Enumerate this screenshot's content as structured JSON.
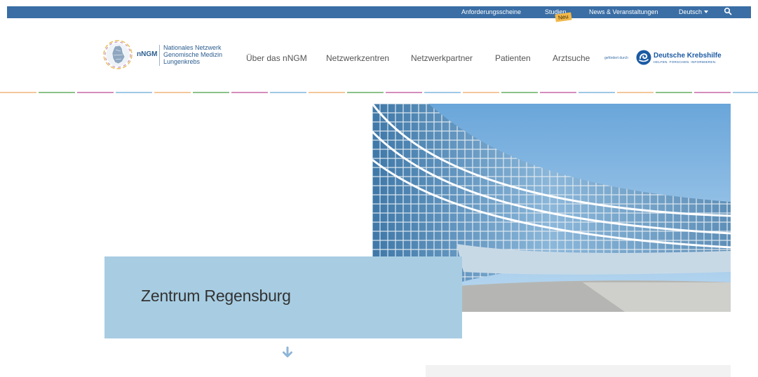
{
  "topbar": {
    "links": [
      "Anforderungsscheine",
      "Studien",
      "News & Veranstaltungen"
    ],
    "badge": "Neu",
    "language": "Deutsch",
    "icons": {
      "search": "search-icon",
      "language_caret": "caret-down-icon"
    },
    "color": "#3a6ea5"
  },
  "logo": {
    "acronym": "nNGM",
    "line1": "Nationales Netzwerk",
    "line2": "Genomische Medizin",
    "line3": "Lungenkrebs",
    "icon": "germany-map-emblem-icon"
  },
  "nav": {
    "items": [
      "Über das nNGM",
      "Netzwerkzentren",
      "Netzwerkpartner",
      "Patienten",
      "Arztsuche"
    ]
  },
  "funder": {
    "prefix": "gefördert durch",
    "name": "Deutsche Krebshilfe",
    "slogan": "HELFEN. FORSCHEN. INFORMIEREN.",
    "icon": "krebshilfe-logo-icon",
    "color": "#1c5aa3"
  },
  "stripe_colors": [
    "#f3c79a",
    "#8cc28a",
    "#d58cbc",
    "#9fc9e6"
  ],
  "hero": {
    "title": "Zentrum Regensburg",
    "box_color": "#a8cde2",
    "scroll_icon": "arrow-down-icon"
  }
}
